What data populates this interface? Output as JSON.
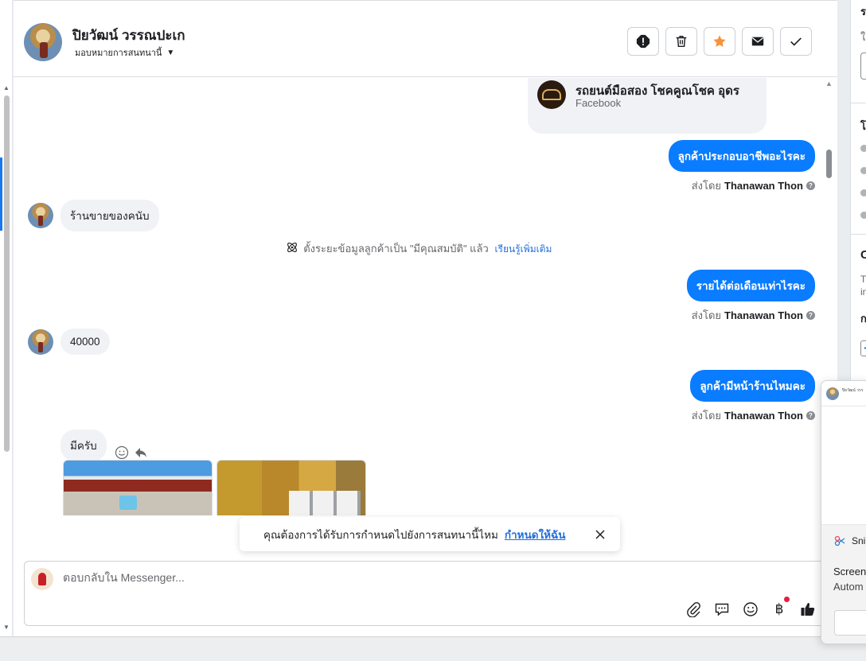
{
  "header": {
    "contact_name": "ปิยวัฒน์ วรรณปะเก",
    "assign_label": "มอบหมายการสนทนานี้"
  },
  "shared_card": {
    "title": "รถยนต์มือสอง โชคคูณโชค อุดร",
    "subtitle": "Facebook"
  },
  "messages": {
    "out1": "ลูกค้าประกอบอาชีพอะไรคะ",
    "in1": "ร้านขายของคนับ",
    "system_note": "ตั้งระยะข้อมูลลูกค้าเป็น \"มีคุณสมบัติ\" แล้ว",
    "system_link": "เรียนรู้เพิ่มเติม",
    "out2": "รายได้ต่อเดือนเท่าไรคะ",
    "in2": "40000",
    "out3": "ลูกค้ามีหน้าร้านไหมคะ",
    "in3": "มีครับ",
    "sent_by_prefix": "ส่งโดย",
    "sent_by_name": "Thanawan Thon",
    "help_mark": "?"
  },
  "toast": {
    "text": "คุณต้องการได้รับการกำหนดไปยังการสนทนานี้ไหม",
    "link": "กำหนดให้ฉัน"
  },
  "composer": {
    "placeholder": "ตอบกลับใน Messenger..."
  },
  "right_panel": {
    "r1": "ร",
    "r2": "ใ",
    "r3": "โ",
    "r4": "C",
    "r5": "T",
    "r6": "in",
    "r7": "ก"
  },
  "popup": {
    "mini_text": "ปิยวัฒน์ วรร",
    "snip": "Sni",
    "line1": "Screen",
    "line2": "Autom"
  },
  "colors": {
    "accent": "#0a7cff",
    "link": "#216fdb",
    "star": "#f7923b",
    "notification_dot": "#e41e3f"
  },
  "icons": {
    "header_buttons": [
      "alert-icon",
      "trash-icon",
      "star-icon",
      "mail-icon",
      "check-icon"
    ],
    "composer_tools": [
      "paperclip-icon",
      "saved-reply-icon",
      "emoji-icon",
      "baht-icon",
      "thumbs-up-icon"
    ]
  }
}
